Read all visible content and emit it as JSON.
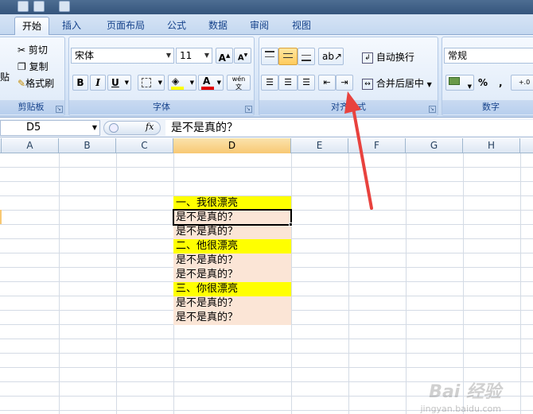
{
  "tabs": [
    "开始",
    "插入",
    "页面布局",
    "公式",
    "数据",
    "审阅",
    "视图"
  ],
  "clipboard": {
    "paste": "贴",
    "cut": "剪切",
    "copy": "复制",
    "format_painter": "格式刷",
    "group": "剪贴板"
  },
  "font": {
    "name": "宋体",
    "size": "11",
    "bold": "B",
    "italic": "I",
    "underline": "U",
    "font_color": "A",
    "phonetic": "wén",
    "group": "字体"
  },
  "alignment": {
    "wrap": "自动换行",
    "merge": "合并后居中",
    "group": "对齐方式"
  },
  "number": {
    "format": "常规",
    "percent": "%",
    "comma": ",",
    "decimal": "+.0",
    "group": "数字"
  },
  "formula_bar": {
    "name_box": "D5",
    "fx": "fx",
    "content": "是不是真的？"
  },
  "columns": [
    "A",
    "B",
    "C",
    "D",
    "E",
    "F",
    "G",
    "H"
  ],
  "cells": [
    {
      "text": "一、我很漂亮",
      "style": "yel"
    },
    {
      "text": "是不是真的？",
      "style": "pch"
    },
    {
      "text": "是不是真的？",
      "style": "pch"
    },
    {
      "text": "二、他很漂亮",
      "style": "yel"
    },
    {
      "text": "是不是真的？",
      "style": "pch"
    },
    {
      "text": "是不是真的？",
      "style": "pch"
    },
    {
      "text": "三、你很漂亮",
      "style": "yel"
    },
    {
      "text": "是不是真的？",
      "style": "pch"
    },
    {
      "text": "是不是真的？",
      "style": "pch"
    }
  ],
  "watermark": {
    "logo": "Bai 经验",
    "url": "jingyan.baidu.com"
  },
  "colors": {
    "highlight": "#ffff00",
    "peach": "#fbe5d6",
    "arrow": "#e8423e"
  }
}
